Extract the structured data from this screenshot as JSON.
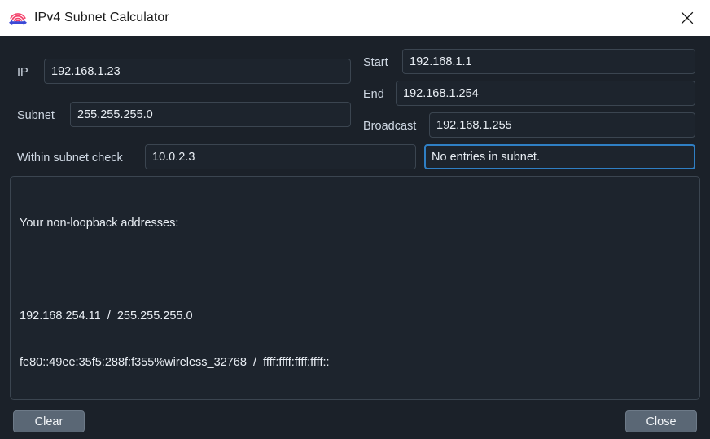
{
  "window": {
    "title": "IPv4 Subnet Calculator",
    "icon": "network-subnet-icon",
    "close_icon": "close-icon"
  },
  "form": {
    "ip": {
      "label": "IP",
      "value": "192.168.1.23"
    },
    "subnet": {
      "label": "Subnet",
      "value": "255.255.255.0"
    },
    "start": {
      "label": "Start",
      "value": "192.168.1.1"
    },
    "end": {
      "label": "End",
      "value": "192.168.1.254"
    },
    "broadcast": {
      "label": "Broadcast",
      "value": "192.168.1.255"
    },
    "within_check": {
      "label": "Within subnet check",
      "value": "10.0.2.3"
    },
    "within_result": {
      "value": "No entries in subnet.",
      "focused": true
    }
  },
  "output": {
    "header": "Your non-loopback addresses:",
    "lines": [
      "192.168.254.11  /  255.255.255.0",
      "fe80::49ee:35f5:288f:f355%wireless_32768  /  ffff:ffff:ffff:ffff::"
    ]
  },
  "buttons": {
    "clear": "Clear",
    "close": "Close"
  },
  "colors": {
    "window_bg": "#1b2129",
    "titlebar_bg": "#ffffff",
    "field_border": "#3b4550",
    "focus_border": "#2f7fc4",
    "button_bg": "#5a6775",
    "text": "#e9eef4",
    "label": "#cfd8e3"
  }
}
